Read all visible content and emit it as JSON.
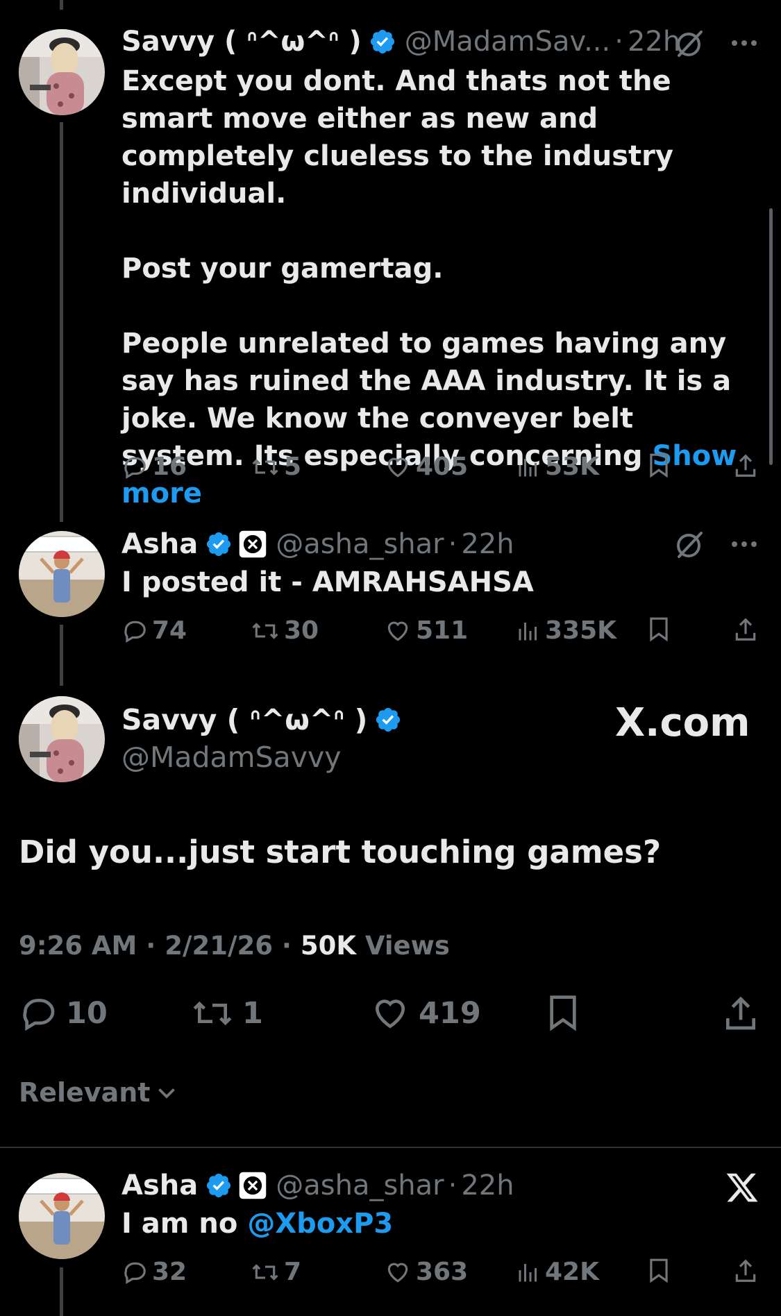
{
  "tweet1": {
    "name": "Savvy ( ᐢ^ω^ᐢ )",
    "handle": "@MadamSav...",
    "dot": "·",
    "time": "22h",
    "paragraphs": [
      "Except you dont. And thats not the smart move either as new and completely clueless to the industry individual.",
      "Post your gamertag.",
      "People unrelated to games having any say has ruined the AAA industry. It is a joke. We know the conveyer belt system. Its especially concerning"
    ],
    "show_more": "Show more",
    "replies": "16",
    "reposts": "5",
    "likes": "405",
    "views": "53K"
  },
  "tweet2": {
    "name": "Asha",
    "handle": "@asha_shar",
    "dot": "·",
    "time": "22h",
    "text": "I posted it - AMRAHSAHSA",
    "replies": "74",
    "reposts": "30",
    "likes": "511",
    "views": "335K"
  },
  "main": {
    "name": "Savvy ( ᐢ^ω^ᐢ )",
    "handle": "@MadamSavvy",
    "watermark": "X.com",
    "text": "Did you...just start touching games?",
    "time": "9:26 AM",
    "dot1": "·",
    "date": "2/21/26",
    "dot2": "·",
    "views_count": "50K",
    "views_label": "Views",
    "replies": "10",
    "reposts": "1",
    "likes": "419"
  },
  "sort": {
    "label": "Relevant"
  },
  "reply": {
    "name": "Asha",
    "handle": "@asha_shar",
    "dot": "·",
    "time": "22h",
    "text_prefix": "I am no",
    "mention": "@XboxP3",
    "replies": "32",
    "reposts": "7",
    "likes": "363",
    "views": "42K"
  },
  "colors": {
    "background": "#000000",
    "text": "#e7e9ea",
    "muted": "#71767b",
    "accent": "#1d9bf0"
  },
  "icons": [
    "verified-badge-icon",
    "xbox-badge-icon",
    "grok-icon",
    "more-icon",
    "reply-icon",
    "repost-icon",
    "like-icon",
    "views-icon",
    "bookmark-icon",
    "share-icon",
    "chevron-down-icon",
    "x-logo-icon"
  ]
}
